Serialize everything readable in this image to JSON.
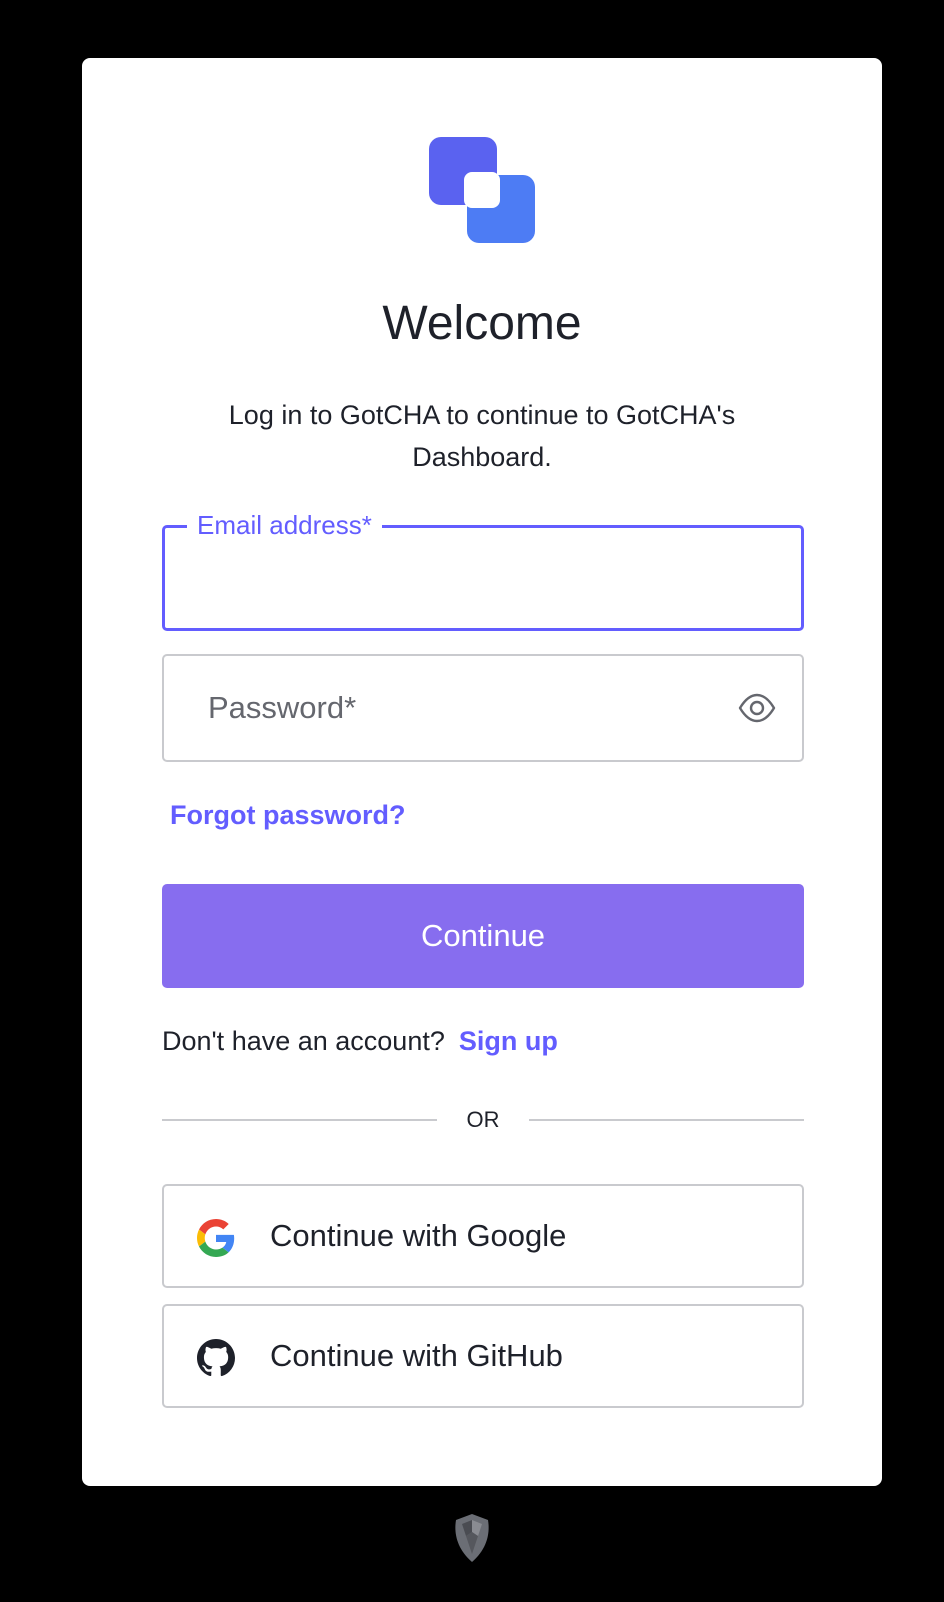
{
  "brand": {
    "name": "GotCHA",
    "colors": {
      "primary": "#635dff",
      "button": "#876def",
      "logo_a": "#5a62f0",
      "logo_b": "#4d7cf4"
    }
  },
  "header": {
    "title": "Welcome",
    "subtitle": "Log in to GotCHA to continue to GotCHA's Dashboard."
  },
  "form": {
    "email": {
      "label": "Email address*",
      "value": ""
    },
    "password": {
      "placeholder": "Password*",
      "value": "",
      "toggle_icon": "eye-icon"
    },
    "forgot_label": "Forgot password?",
    "continue_label": "Continue"
  },
  "signup": {
    "prompt": "Don't have an account?",
    "link_label": "Sign up"
  },
  "divider": {
    "label": "OR"
  },
  "social": {
    "google": {
      "label": "Continue with Google",
      "icon": "google-icon"
    },
    "github": {
      "label": "Continue with GitHub",
      "icon": "github-icon"
    }
  },
  "footer": {
    "icon": "auth0-shield-icon"
  }
}
